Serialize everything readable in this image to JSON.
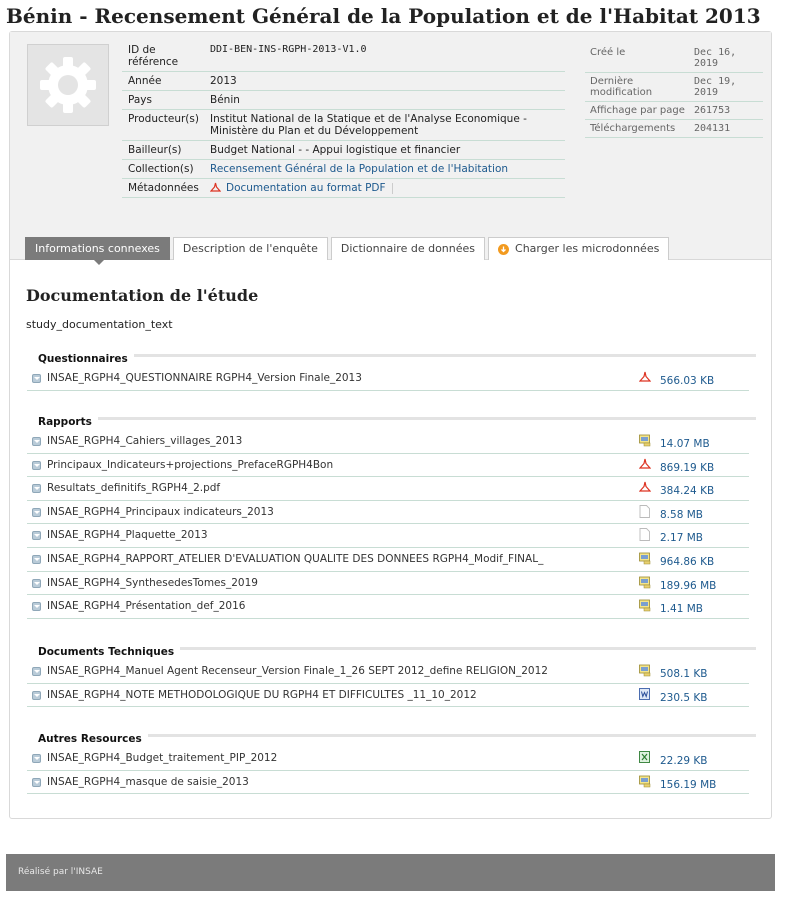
{
  "title": "Bénin - Recensement Général de la Population et de l'Habitat 2013",
  "meta": {
    "ref_label": "ID de référence",
    "ref_value": "DDI-BEN-INS-RGPH-2013-V1.0",
    "year_label": "Année",
    "year_value": "2013",
    "country_label": "Pays",
    "country_value": "Bénin",
    "producer_label": "Producteur(s)",
    "producer_value": "Institut National de la Statique et de l'Analyse Economique - Ministère du Plan et du Développement",
    "funder_label": "Bailleur(s)",
    "funder_value": "Budget National - - Appui logistique et financier",
    "collection_label": "Collection(s)",
    "collection_value": "Recensement Général de la Population et de l'Habitation",
    "metadata_label": "Métadonnées",
    "metadata_link": "Documentation au format PDF"
  },
  "stats": {
    "created_label": "Créé le",
    "created_value": "Dec 16, 2019",
    "modified_label": "Dernière modification",
    "modified_value": "Dec 19, 2019",
    "views_label": "Affichage par page",
    "views_value": "261753",
    "downloads_label": "Téléchargements",
    "downloads_value": "204131"
  },
  "tabs": [
    {
      "label": "Informations connexes"
    },
    {
      "label": "Description de l'enquête"
    },
    {
      "label": "Dictionnaire de données"
    },
    {
      "label": "Charger les microdonnées"
    }
  ],
  "doc": {
    "title": "Documentation de l'étude",
    "text": "study_documentation_text"
  },
  "sections": [
    {
      "title": "Questionnaires",
      "files": [
        {
          "name": "INSAE_RGPH4_QUESTIONNAIRE RGPH4_Version Finale_2013",
          "size": "566.03 KB",
          "icon": "pdf-icon"
        }
      ]
    },
    {
      "title": "Rapports",
      "files": [
        {
          "name": "INSAE_RGPH4_Cahiers_villages_2013",
          "size": "14.07 MB",
          "icon": "document-icon"
        },
        {
          "name": "Principaux_Indicateurs+projections_PrefaceRGPH4Bon",
          "size": "869.19 KB",
          "icon": "pdf-icon"
        },
        {
          "name": "Resultats_definitifs_RGPH4_2.pdf",
          "size": "384.24 KB",
          "icon": "pdf-icon"
        },
        {
          "name": "INSAE_RGPH4_Principaux indicateurs_2013",
          "size": "8.58 MB",
          "icon": "blank-file-icon"
        },
        {
          "name": "INSAE_RGPH4_Plaquette_2013",
          "size": "2.17 MB",
          "icon": "blank-file-icon"
        },
        {
          "name": "INSAE_RGPH4_RAPPORT_ATELIER D'EVALUATION QUALITE DES DONNEES RGPH4_Modif_FINAL_",
          "size": "964.86 KB",
          "icon": "document-icon"
        },
        {
          "name": "INSAE_RGPH4_SynthesedesTomes_2019",
          "size": "189.96 MB",
          "icon": "document-icon"
        },
        {
          "name": "INSAE_RGPH4_Présentation_def_2016",
          "size": "1.41 MB",
          "icon": "document-icon"
        }
      ]
    },
    {
      "title": "Documents Techniques",
      "files": [
        {
          "name": "INSAE_RGPH4_Manuel Agent Recenseur_Version Finale_1_26 SEPT 2012_define RELIGION_2012",
          "size": "508.1 KB",
          "icon": "document-icon"
        },
        {
          "name": "INSAE_RGPH4_NOTE METHODOLOGIQUE DU RGPH4 ET DIFFICULTES _11_10_2012",
          "size": "230.5 KB",
          "icon": "word-icon"
        }
      ]
    },
    {
      "title": "Autres Resources",
      "files": [
        {
          "name": "INSAE_RGPH4_Budget_traitement_PIP_2012",
          "size": "22.29 KB",
          "icon": "excel-icon"
        },
        {
          "name": "INSAE_RGPH4_masque de saisie_2013",
          "size": "156.19 MB",
          "icon": "document-icon"
        }
      ]
    }
  ],
  "footer": {
    "text": "Réalisé par l'INSAE"
  }
}
